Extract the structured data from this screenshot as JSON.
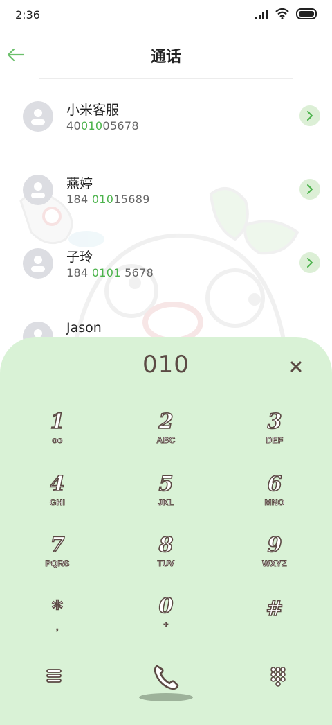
{
  "status": {
    "time": "2:36"
  },
  "header": {
    "title": "通话"
  },
  "contacts": [
    {
      "name": "小米客服",
      "num_pre": "40",
      "num_hl": "010",
      "num_post": "05678"
    },
    {
      "name": "燕婷",
      "num_pre": "184 ",
      "num_hl": "010",
      "num_post": "15689"
    },
    {
      "name": "子玲",
      "num_pre": "184 ",
      "num_hl": "0101",
      "num_post": " 5678"
    },
    {
      "name": "Jason"
    }
  ],
  "dialpad": {
    "dialed": "010",
    "keys": [
      {
        "digit": "1",
        "letters": "oo"
      },
      {
        "digit": "2",
        "letters": "ABC"
      },
      {
        "digit": "3",
        "letters": "DEF"
      },
      {
        "digit": "4",
        "letters": "GHI"
      },
      {
        "digit": "5",
        "letters": "JKL"
      },
      {
        "digit": "6",
        "letters": "MNO"
      },
      {
        "digit": "7",
        "letters": "PQRS"
      },
      {
        "digit": "8",
        "letters": "TUV"
      },
      {
        "digit": "9",
        "letters": "WXYZ"
      },
      {
        "digit": "*",
        "letters": ","
      },
      {
        "digit": "0",
        "letters": "+"
      },
      {
        "digit": "#",
        "letters": ""
      }
    ]
  },
  "colors": {
    "accent": "#4cb34c",
    "panel": "#d9f2d6",
    "ink": "#5b4a44"
  },
  "icons": [
    "signal-icon",
    "wifi-icon",
    "battery-icon",
    "back-arrow-icon",
    "chevron-right-icon",
    "clear-icon",
    "menu-icon",
    "phone-icon",
    "keypad-icon"
  ]
}
